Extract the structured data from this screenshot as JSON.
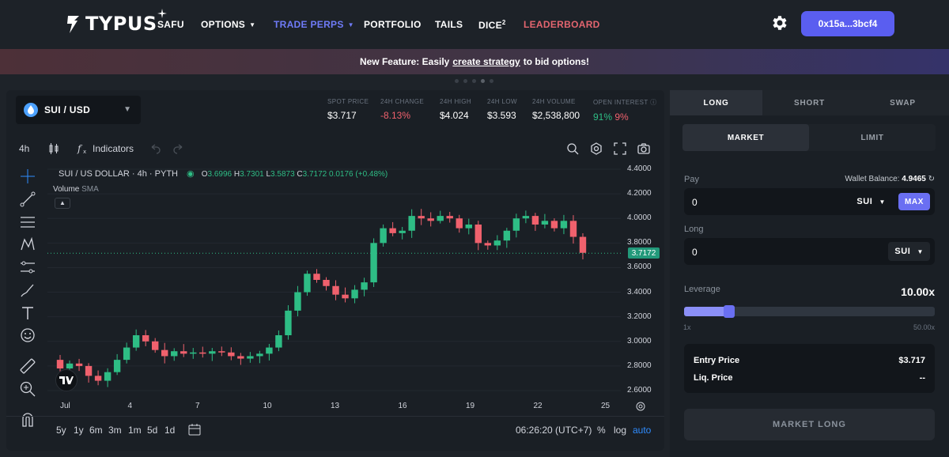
{
  "brand": {
    "name": "TYPUS",
    "accent": "#5a5ef0"
  },
  "nav": {
    "items": [
      {
        "label": "SAFU"
      },
      {
        "label": "OPTIONS"
      },
      {
        "label": "TRADE PERPS"
      },
      {
        "label": "PORTFOLIO"
      },
      {
        "label": "TAILS"
      },
      {
        "label": "DICE",
        "sup": "2"
      },
      {
        "label": "LEADERBOARD"
      }
    ],
    "wallet": "0x15a...3bcf4",
    "settings_icon": "gear-icon"
  },
  "banner": {
    "prefix": "New Feature: Easily",
    "link": "create strategy",
    "suffix": "to bid options!"
  },
  "market": {
    "pair": "SUI / USD",
    "stats": [
      {
        "label": "SPOT PRICE",
        "value": "$3.717"
      },
      {
        "label": "24H CHANGE",
        "value": "-8.13%"
      },
      {
        "label": "24H HIGH",
        "value": "$4.024"
      },
      {
        "label": "24H LOW",
        "value": "$3.593"
      },
      {
        "label": "24H VOLUME",
        "value": "$2,538,800"
      },
      {
        "label": "OPEN INTEREST",
        "long": "91%",
        "short": "9%"
      }
    ]
  },
  "chart_toolbar": {
    "interval": "4h",
    "indicators": "Indicators"
  },
  "chart_legend": {
    "title": "SUI / US DOLLAR · 4h · PYTH",
    "o_label": "O",
    "o": "3.6996",
    "h_label": "H",
    "h": "3.7301",
    "l_label": "L",
    "l": "3.5873",
    "c_label": "C",
    "c": "3.7172",
    "change": "0.0176 (+0.48%)",
    "volume": "Volume",
    "volume_ma": "SMA"
  },
  "chart_data": {
    "type": "candlestick",
    "ylim": [
      2.6,
      4.4
    ],
    "y_ticks": [
      "4.4000",
      "4.2000",
      "4.0000",
      "3.8000",
      "3.6000",
      "3.4000",
      "3.2000",
      "3.0000",
      "2.8000",
      "2.6000"
    ],
    "x_ticks": [
      "Jul",
      "4",
      "7",
      "10",
      "13",
      "16",
      "19",
      "22",
      "25"
    ],
    "last_price": "3.7172",
    "up_color": "#2ebd85",
    "down_color": "#f0616d",
    "close_path": [
      2.85,
      2.78,
      2.82,
      2.8,
      2.72,
      2.68,
      2.75,
      2.85,
      2.95,
      3.05,
      3.0,
      2.93,
      2.88,
      2.92,
      2.9,
      2.91,
      2.9,
      2.92,
      2.91,
      2.88,
      2.86,
      2.88,
      2.9,
      2.95,
      3.05,
      3.25,
      3.4,
      3.55,
      3.5,
      3.45,
      3.38,
      3.35,
      3.42,
      3.48,
      3.8,
      3.92,
      3.88,
      3.9,
      4.02,
      4.0,
      3.98,
      4.02,
      4.0,
      3.92,
      3.95,
      3.8,
      3.78,
      3.82,
      3.9,
      4.0,
      4.02,
      3.95,
      3.98,
      3.92,
      3.98,
      3.85,
      3.72
    ],
    "bottom_bar": {
      "timeframes": [
        "5y",
        "1y",
        "6m",
        "3m",
        "1m",
        "5d",
        "1d"
      ],
      "time": "06:26:20 (UTC+7)",
      "pct": "%",
      "log": "log",
      "auto": "auto"
    }
  },
  "trade": {
    "side_tabs": [
      "LONG",
      "SHORT",
      "SWAP"
    ],
    "type_tabs": [
      "MARKET",
      "LIMIT"
    ],
    "pay_label": "Pay",
    "wallet_balance_label": "Wallet Balance:",
    "wallet_balance": "4.9465",
    "pay_value": "0",
    "pay_asset": "SUI",
    "max_label": "MAX",
    "long_label": "Long",
    "long_value": "0",
    "long_asset": "SUI",
    "leverage_label": "Leverage",
    "leverage_value": "10.00x",
    "leverage_fraction": 0.18,
    "leverage_min": "1x",
    "leverage_max": "50.00x",
    "entry_price_label": "Entry Price",
    "entry_price": "$3.717",
    "liq_price_label": "Liq. Price",
    "liq_price": "--",
    "submit_label": "MARKET LONG"
  }
}
